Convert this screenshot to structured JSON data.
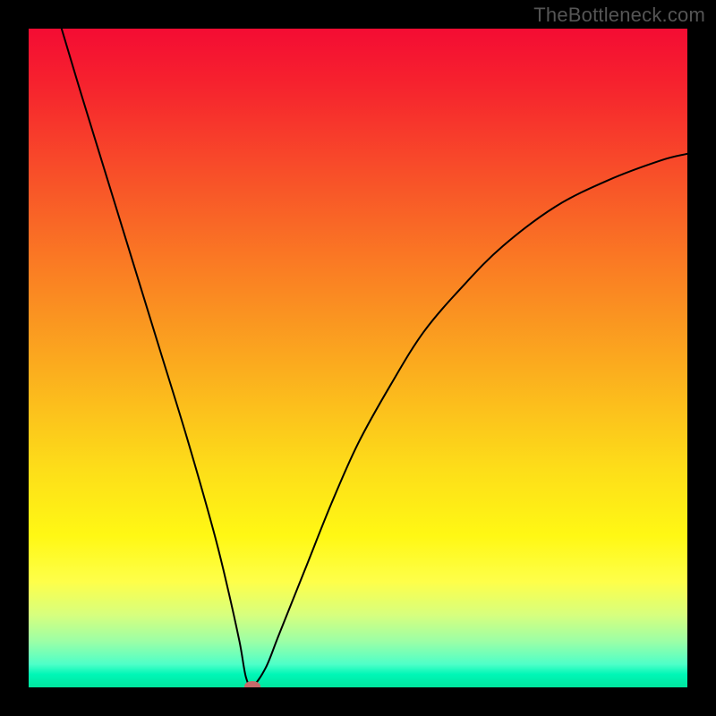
{
  "watermark": "TheBottleneck.com",
  "chart_data": {
    "type": "line",
    "title": "",
    "xlabel": "",
    "ylabel": "",
    "xlim": [
      0,
      100
    ],
    "ylim": [
      0,
      100
    ],
    "grid": false,
    "legend": false,
    "background_gradient": {
      "direction": "vertical",
      "stops": [
        {
          "pos": 0.0,
          "color": "#f40c33"
        },
        {
          "pos": 0.08,
          "color": "#f6212e"
        },
        {
          "pos": 0.22,
          "color": "#f84f29"
        },
        {
          "pos": 0.37,
          "color": "#fa7f23"
        },
        {
          "pos": 0.52,
          "color": "#fbae1e"
        },
        {
          "pos": 0.67,
          "color": "#fdde19"
        },
        {
          "pos": 0.77,
          "color": "#fff814"
        },
        {
          "pos": 0.84,
          "color": "#feff4a"
        },
        {
          "pos": 0.89,
          "color": "#d7ff7e"
        },
        {
          "pos": 0.93,
          "color": "#9cffa6"
        },
        {
          "pos": 0.965,
          "color": "#4effc8"
        },
        {
          "pos": 0.98,
          "color": "#00f7b7"
        },
        {
          "pos": 1.0,
          "color": "#00e59e"
        }
      ]
    },
    "series": [
      {
        "name": "bottleneck-curve",
        "color": "#000000",
        "stroke_width": 2,
        "x": [
          5,
          8,
          12,
          16,
          20,
          24,
          28,
          30,
          32,
          33,
          34,
          36,
          38,
          42,
          46,
          50,
          55,
          60,
          66,
          72,
          80,
          88,
          96,
          100
        ],
        "y": [
          100,
          90,
          77,
          64,
          51,
          38,
          24,
          16,
          7,
          1.5,
          0.2,
          3,
          8,
          18,
          28,
          37,
          46,
          54,
          61,
          67,
          73,
          77,
          80,
          81
        ]
      }
    ],
    "marker": {
      "name": "optimal-point",
      "x": 34,
      "y": 0.2,
      "color": "#c76a6a"
    }
  }
}
